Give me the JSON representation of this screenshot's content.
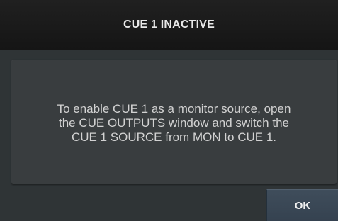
{
  "dialog": {
    "title": "CUE 1 INACTIVE",
    "message_line1": "To enable CUE 1 as a monitor source, open",
    "message_line2": "the CUE OUTPUTS window and switch the",
    "message_line3": "CUE 1 SOURCE from MON to CUE 1.",
    "ok_label": "OK"
  },
  "colors": {
    "title_bar": "#1b1b1b",
    "body": "#2f3436",
    "panel": "#393d3f",
    "button": "#3a4856",
    "text": "#d2d2d2"
  }
}
